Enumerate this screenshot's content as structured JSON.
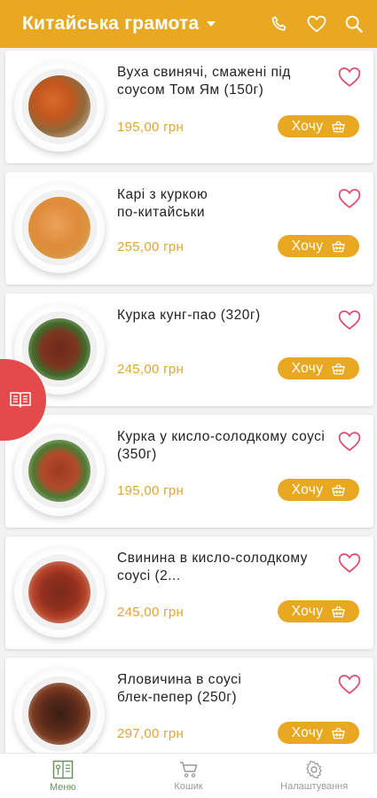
{
  "header": {
    "title": "Китайська грамота"
  },
  "items": [
    {
      "name": "Вуха свинячі, смажені під соусом Том Ям (150г)",
      "price": "195,00 грн",
      "button": "Хочу"
    },
    {
      "name": "Карі з куркою по-китайськи",
      "price": "255,00 грн",
      "button": "Хочу"
    },
    {
      "name": "Курка кунг-пао (320г)",
      "price": "245,00 грн",
      "button": "Хочу"
    },
    {
      "name": "Курка у кисло-солодкому соусі (350г)",
      "price": "195,00 грн",
      "button": "Хочу"
    },
    {
      "name": "Свинина в кисло-солодкому соусі (2...",
      "price": "245,00 грн",
      "button": "Хочу"
    },
    {
      "name": "Яловичина в соусі блек-пепер (250г)",
      "price": "297,00 грн",
      "button": "Хочу"
    }
  ],
  "nav": {
    "menu": "Меню",
    "cart": "Кошик",
    "settings": "Налаштування"
  },
  "colors": {
    "accent": "#e9a822",
    "heart": "#e14b6e",
    "side_tab": "#e54a4a",
    "nav_active": "#6a8f5c"
  }
}
